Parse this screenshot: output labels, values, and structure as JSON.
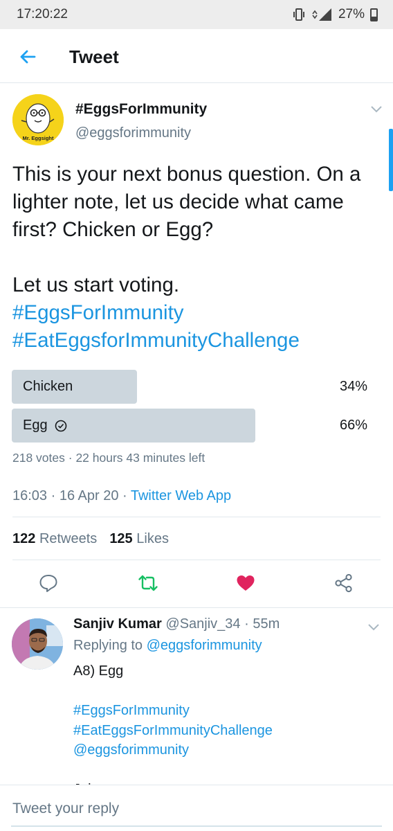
{
  "status_bar": {
    "time": "17:20:22",
    "network": "4G",
    "battery": "27%"
  },
  "header": {
    "title": "Tweet"
  },
  "tweet": {
    "author_name": "#EggsForImmunity",
    "author_handle": "@eggsforimmunity",
    "avatar_caption": "Mr. Eggsight",
    "text_lines": [
      "This is your next bonus question. On a",
      "lighter note, let us decide what came",
      "first? Chicken or Egg?"
    ],
    "text_line_4": "Let us start voting.",
    "hashtags": [
      "#EggsForImmunity",
      "#EatEggsforImmunityChallenge"
    ],
    "poll": {
      "options": [
        {
          "label": "Chicken",
          "percent_label": "34%",
          "percent": 34,
          "selected": false
        },
        {
          "label": "Egg",
          "percent_label": "66%",
          "percent": 66,
          "selected": true
        }
      ],
      "meta": "218 votes · 22 hours 43 minutes left"
    },
    "timestamp": "16:03 · 16 Apr 20 · ",
    "source": "Twitter Web App",
    "retweets_count": "122",
    "retweets_label": "Retweets",
    "likes_count": "125",
    "likes_label": "Likes",
    "colors": {
      "accent": "#1b95e0",
      "retweet": "#17bf63",
      "like": "#e0245e"
    }
  },
  "actions": [
    "reply-icon",
    "retweet-icon",
    "like-icon",
    "share-icon"
  ],
  "reply": {
    "author_name": "Sanjiv Kumar",
    "author_handle": "@Sanjiv_34",
    "time": " · 55m",
    "replying_to_label": "Replying to ",
    "replying_to_handle": "@eggsforimmunity",
    "body_line_1": "A8) Egg",
    "body_line_2": "#EggsForImmunity",
    "body_line_3": "#EatEggsForImmunityChallenge",
    "body_line_4": "@eggsforimmunity",
    "body_line_5": "Join"
  },
  "composer": {
    "placeholder": "Tweet your reply"
  }
}
